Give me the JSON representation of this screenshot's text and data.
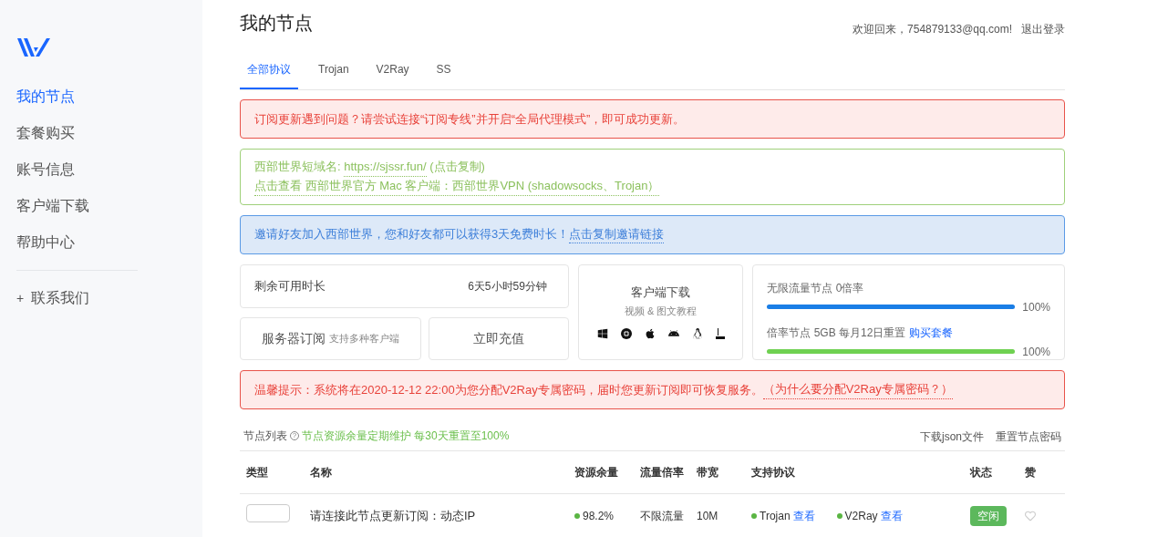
{
  "sidebar": {
    "items": [
      {
        "label": "我的节点",
        "selected": true
      },
      {
        "label": "套餐购买",
        "selected": false
      },
      {
        "label": "账号信息",
        "selected": false
      },
      {
        "label": "客户端下载",
        "selected": false
      },
      {
        "label": "帮助中心",
        "selected": false
      }
    ],
    "contact": {
      "icon": "+",
      "label": "联系我们"
    }
  },
  "header": {
    "title": "我的节点",
    "welcome": "欢迎回来，754879133@qq.com!",
    "logout": "退出登录"
  },
  "tabs": [
    {
      "label": "全部协议",
      "selected": true
    },
    {
      "label": "Trojan",
      "selected": false
    },
    {
      "label": "V2Ray",
      "selected": false
    },
    {
      "label": "SS",
      "selected": false
    }
  ],
  "alert_error": "订阅更新遇到问题？请尝试连接“订阅专线”并开启“全局代理模式”，即可成功更新。",
  "info_box": {
    "domain_label": "西部世界短域名: ",
    "domain_link": "https://sjssr.fun/",
    "domain_suffix": " (点击复制)",
    "mac_link": "点击查看 西部世界官方 Mac 客户端：西部世界VPN (shadowsocks、Trojan）"
  },
  "invite": {
    "text": "邀请好友加入西部世界，您和好友都可以获得3天免费时长！",
    "link": "点击复制邀请链接"
  },
  "remaining": {
    "label": "剩余可用时长",
    "value": "6天5小时59分钟"
  },
  "subscription": {
    "label": "服务器订阅",
    "hint": "支持多种客户端"
  },
  "recharge": "立即充值",
  "download": {
    "title": "客户端下载",
    "subtitle": "视频 & 图文教程"
  },
  "traffic": [
    {
      "label": "无限流量节点 0倍率",
      "level": 1.0,
      "reading": "100%",
      "color": "#1a7ee6"
    },
    {
      "label": "倍率节点 5GB 每月12日重置 ",
      "link": "购买套餐",
      "level": 1.0,
      "reading": "100%",
      "color": "#6fd151"
    }
  ],
  "warning": {
    "text": "温馨提示：系统将在2020-12-12 22:00为您分配V2Ray专属密码，届时您更新订阅即可恢复服务。",
    "link": "（为什么要分配V2Ray专属密码？）"
  },
  "node_list": {
    "title": "节点列表",
    "help_icon": "?",
    "note": "节点资源余量定期维护 每30天重置至100%",
    "actions": [
      "下载json文件",
      "重置节点密码"
    ]
  },
  "table": {
    "columns": [
      "类型",
      "名称",
      "资源余量",
      "流量倍率",
      "带宽",
      "支持协议",
      "状态",
      "赞"
    ],
    "rows": [
      {
        "name": "请连接此节点更新订阅：动态IP",
        "remaining": "98.2%",
        "rate": "不限流量",
        "bandwidth": "10M",
        "protocols": [
          {
            "name": "Trojan",
            "link": "查看"
          },
          {
            "name": "V2Ray",
            "link": "查看"
          }
        ],
        "status": "空闲",
        "liked": false
      }
    ]
  }
}
